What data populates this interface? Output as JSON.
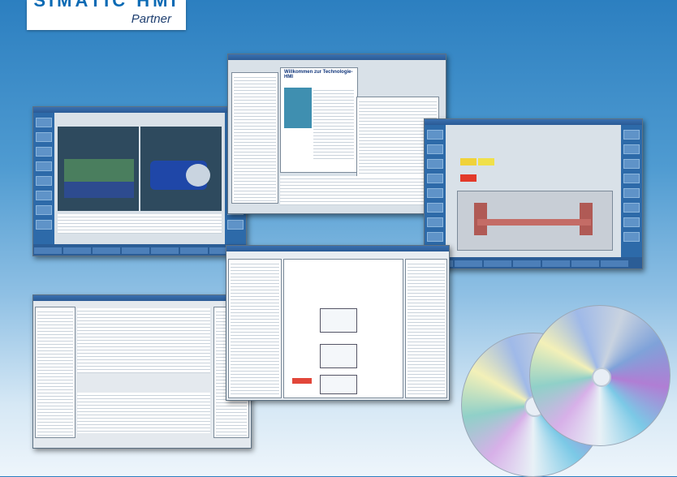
{
  "logo": {
    "brand": "SIMATIC HMI",
    "partner": "Partner"
  },
  "window_text": {
    "welcome": "Willkommen zur Technologie-HMI"
  },
  "colors": {
    "background_top": "#2c7fc0",
    "background_bottom": "#eef5fb",
    "window_bar": "#2a5a95"
  }
}
